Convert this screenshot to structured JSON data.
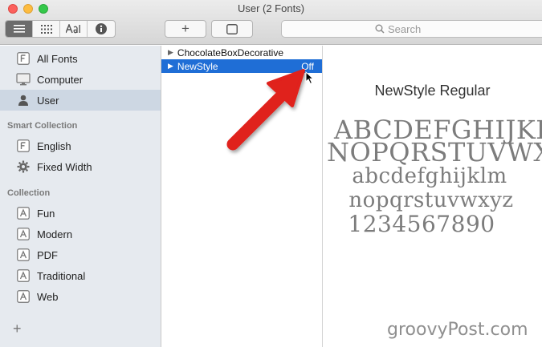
{
  "window": {
    "title": "User (2 Fonts)"
  },
  "toolbar": {
    "view_buttons": [
      "list-view-icon",
      "grid-view-icon",
      "sample-view-icon",
      "info-icon"
    ],
    "add_label": "+",
    "search_placeholder": "Search"
  },
  "sidebar": {
    "library": [
      {
        "label": "All Fonts",
        "icon": "font-library-icon"
      },
      {
        "label": "Computer",
        "icon": "computer-icon"
      },
      {
        "label": "User",
        "icon": "user-icon",
        "selected": true
      }
    ],
    "smart_heading": "Smart Collection",
    "smart": [
      {
        "label": "English",
        "icon": "font-library-icon"
      },
      {
        "label": "Fixed Width",
        "icon": "gear-icon"
      }
    ],
    "collection_heading": "Collection",
    "collections": [
      {
        "label": "Fun"
      },
      {
        "label": "Modern"
      },
      {
        "label": "PDF"
      },
      {
        "label": "Traditional"
      },
      {
        "label": "Web"
      }
    ],
    "add_label": "+"
  },
  "fonts": [
    {
      "name": "ChocolateBoxDecorative",
      "status": "",
      "selected": false
    },
    {
      "name": "NewStyle",
      "status": "Off",
      "selected": true
    }
  ],
  "preview": {
    "title": "NewStyle Regular",
    "lines": [
      "ABCDEFGHIJKLM",
      "NOPQRSTUVWXYZ",
      "abcdefghijklm",
      "nopqrstuvwxyz",
      "1234567890"
    ]
  },
  "watermark": "groovyPost.com",
  "colors": {
    "selection": "#1f6ed6",
    "sidebar_bg": "#e6eaef",
    "arrow": "#e0201e"
  }
}
